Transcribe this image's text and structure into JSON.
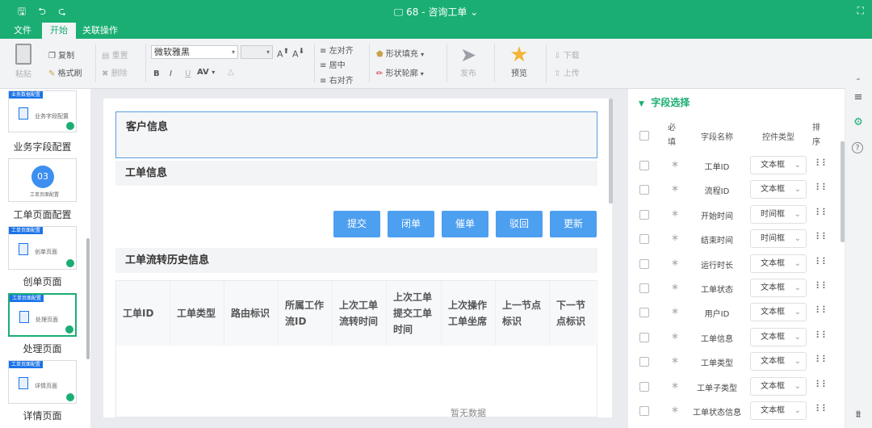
{
  "title_bar": {
    "doc_title": "68 - 咨询工单",
    "save_icon": "save-icon",
    "undo_icon": "undo-icon",
    "redo_icon": "redo-icon"
  },
  "menu": {
    "items": [
      "文件",
      "开始",
      "关联操作"
    ],
    "active": "开始"
  },
  "ribbon": {
    "paste": "粘贴",
    "copy": "复制",
    "format_painter": "格式刷",
    "redo": "重置",
    "delete": "删除",
    "font_name": "微软雅黑",
    "font_size": "",
    "bold": "B",
    "italic": "I",
    "underline": "U",
    "spacing": "AV",
    "align_left": "左对齐",
    "align_center": "居中",
    "align_right": "右对齐",
    "shape_fill": "形状填充",
    "shape_outline": "形状轮廓",
    "publish": "发布",
    "preview": "预览",
    "download": "下载",
    "upload": "上传"
  },
  "left_panel": {
    "pages": [
      {
        "tag": "业务数据配置",
        "inner": "业务字段配置",
        "label": "业务字段配置"
      },
      {
        "tag": "",
        "inner": "工单页面配置",
        "label": "工单页面配置",
        "circle": "03"
      },
      {
        "tag": "工单页面配置",
        "inner": "创单页面",
        "label": "创单页面"
      },
      {
        "tag": "工单页面配置",
        "inner": "处理页面",
        "label": "处理页面"
      },
      {
        "tag": "工单页面配置",
        "inner": "详情页面",
        "label": "详情页面"
      }
    ],
    "selected": "处理页面"
  },
  "canvas": {
    "sections": {
      "customer": "客户信息",
      "workorder": "工单信息",
      "history": "工单流转历史信息"
    },
    "buttons": [
      "提交",
      "闭单",
      "催单",
      "驳回",
      "更新"
    ],
    "table_headers": [
      "工单ID",
      "工单类型",
      "路由标识",
      "所属工作流ID",
      "上次工单流转时间",
      "上次工单提交工单时间",
      "上次操作工单坐席",
      "上一节点标识",
      "下一节点标识"
    ],
    "empty_text": "暂无数据"
  },
  "field_panel": {
    "title": "字段选择",
    "headers": {
      "required": "必填",
      "name": "字段名称",
      "control": "控件类型",
      "sort": "排序"
    },
    "fields": [
      {
        "name": "工单ID",
        "control": "文本框"
      },
      {
        "name": "流程ID",
        "control": "文本框"
      },
      {
        "name": "开始时间",
        "control": "时间框"
      },
      {
        "name": "结束时间",
        "control": "时间框"
      },
      {
        "name": "运行时长",
        "control": "文本框"
      },
      {
        "name": "工单状态",
        "control": "文本框"
      },
      {
        "name": "用户ID",
        "control": "文本框"
      },
      {
        "name": "工单信息",
        "control": "文本框"
      },
      {
        "name": "工单类型",
        "control": "文本框"
      },
      {
        "name": "工单子类型",
        "control": "文本框"
      },
      {
        "name": "工单状态信息",
        "control": "文本框"
      }
    ]
  },
  "colors": {
    "brand": "#1aae73",
    "button": "#4d9ff0"
  }
}
